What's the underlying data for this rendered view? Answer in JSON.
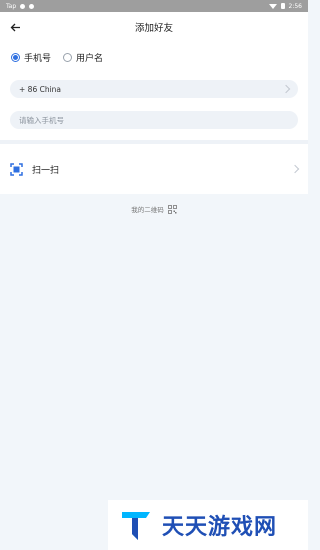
{
  "statusbar": {
    "left_text": "Tap",
    "time": "2:56"
  },
  "header": {
    "title": "添加好友"
  },
  "radio": [
    {
      "label": "手机号",
      "checked": true
    },
    {
      "label": "用户名",
      "checked": false
    }
  ],
  "country": {
    "value": "+ 86 China"
  },
  "phone": {
    "placeholder": "请输入手机号"
  },
  "scan": {
    "label": "扫一扫"
  },
  "qr": {
    "label": "我的二维码"
  },
  "watermark": {
    "text": "天天游戏网"
  },
  "colors": {
    "accent": "#2e6fe0",
    "background": "#f2f6fa",
    "brand_blue": "#1f4fb5",
    "brand_cyan": "#00b6ff"
  }
}
